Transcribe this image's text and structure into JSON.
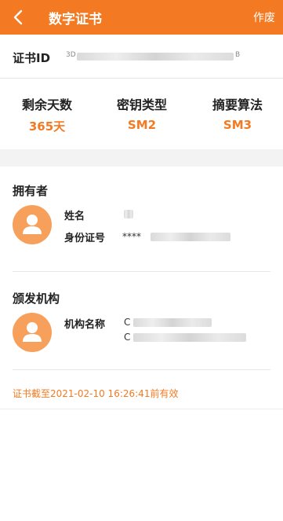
{
  "header": {
    "title": "数字证书",
    "action_label": "作废",
    "accent": "#f37a22"
  },
  "cert": {
    "id_label": "证书ID",
    "id_value": "3D",
    "id_tail": "B"
  },
  "stats": [
    {
      "label": "剩余天数",
      "value": "365天"
    },
    {
      "label": "密钥类型",
      "value": "SM2"
    },
    {
      "label": "摘要算法",
      "value": "SM3"
    }
  ],
  "owner": {
    "section_title": "拥有者",
    "name_label": "姓名",
    "id_label": "身份证号",
    "id_value": "****"
  },
  "issuer": {
    "section_title": "颁发机构",
    "org_label": "机构名称",
    "org_line1": "C",
    "org_line2": "C"
  },
  "expiry": "证书截至2021-02-10 16:26:41前有效"
}
